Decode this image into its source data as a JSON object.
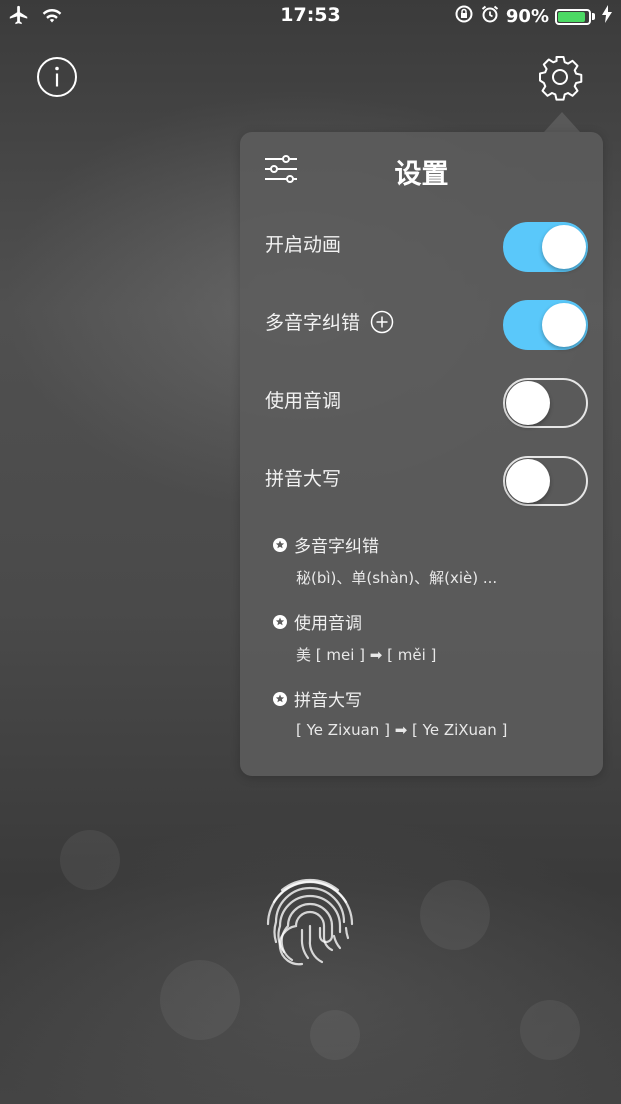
{
  "status_bar": {
    "time": "17:53",
    "battery_percent": "90%",
    "battery_level": 0.9,
    "left_icons": [
      "airplane-icon",
      "wifi-icon"
    ],
    "right_icons": [
      "rotation-lock-icon",
      "alarm-icon",
      "battery-icon",
      "charging-bolt-icon"
    ]
  },
  "top_bar": {
    "left_icon": "info-icon",
    "right_icon": "gear-icon"
  },
  "settings_panel": {
    "title": "设置",
    "header_icon": "sliders-icon",
    "toggles": [
      {
        "label": "开启动画",
        "on": true
      },
      {
        "label": "多音字纠错",
        "on": true,
        "extra_icon": "plus-circle-icon"
      },
      {
        "label": "使用音调",
        "on": false
      },
      {
        "label": "拼音大写",
        "on": false
      }
    ],
    "notes": [
      {
        "title": "多音字纠错",
        "example": "秘(bì)、单(shàn)、解(xiè) ..."
      },
      {
        "title": "使用音调",
        "example": "美 [ mei ] ➡ [ měi ]"
      },
      {
        "title": "拼音大写",
        "example": "[ Ye Zixuan ] ➡ [ Ye ZiXuan ]"
      }
    ]
  },
  "bottom": {
    "icon": "fingerprint-icon"
  },
  "colors": {
    "toggle_on": "#5ac8fa",
    "battery": "#4cd964",
    "panel": "#5c5c5c"
  }
}
